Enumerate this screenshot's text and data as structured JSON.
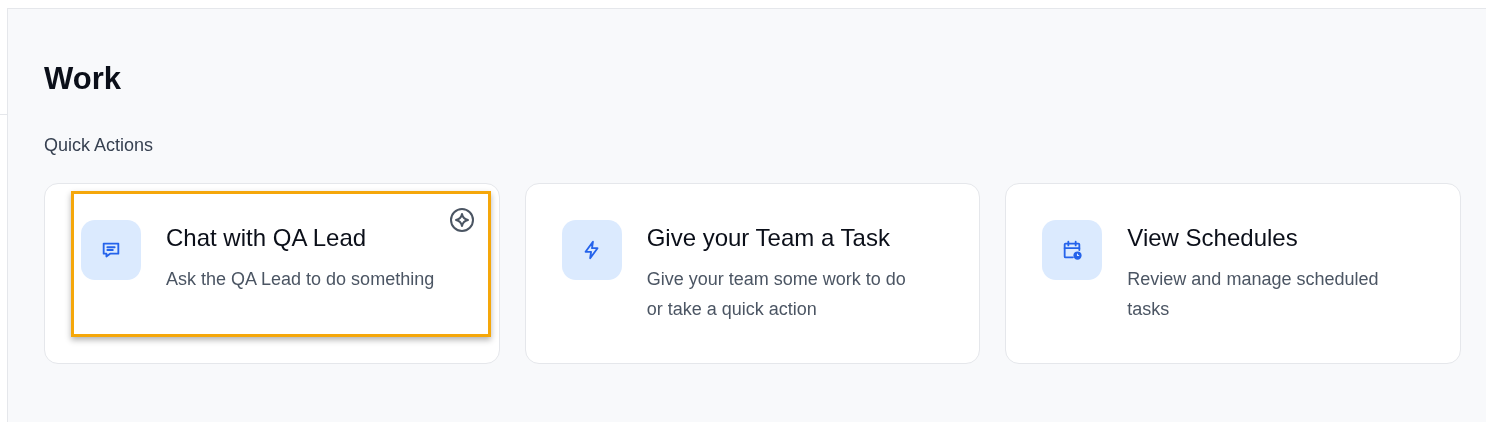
{
  "page": {
    "title": "Work"
  },
  "section": {
    "title": "Quick Actions"
  },
  "actions": [
    {
      "kind": "chat",
      "title": "Chat with QA Lead",
      "description": "Ask the QA Lead to do something",
      "highlighted": true
    },
    {
      "kind": "task",
      "title": "Give your Team a Task",
      "description": "Give your team some work to do or take a quick action",
      "highlighted": false
    },
    {
      "kind": "schedule",
      "title": "View Schedules",
      "description": "Review and manage scheduled tasks",
      "highlighted": false
    }
  ]
}
